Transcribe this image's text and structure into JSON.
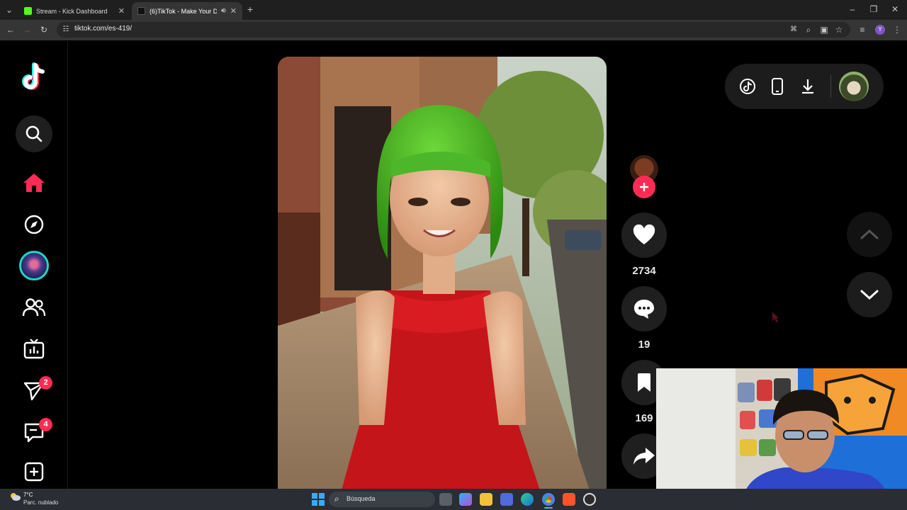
{
  "browser": {
    "tabs": [
      {
        "title": "Stream - Kick Dashboard"
      },
      {
        "title": "(6)TikTok - Make Your Day"
      }
    ],
    "url": "tiktok.com/es-419/"
  },
  "sidebar": {
    "messages_badge": "2",
    "inbox_badge": "4"
  },
  "video": {
    "likes": "2734",
    "comments": "19",
    "saves": "169"
  },
  "taskbar": {
    "weather_temp": "7°C",
    "weather_desc": "Parc. nublado",
    "search_placeholder": "Búsqueda"
  },
  "colors": {
    "brand": "#fe2c55",
    "background": "#000000",
    "surface": "#1f1f1f"
  }
}
